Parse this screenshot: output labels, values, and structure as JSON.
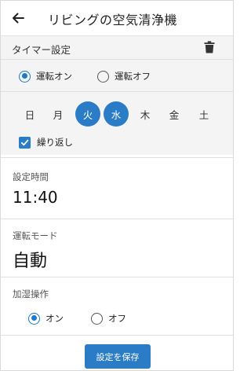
{
  "header": {
    "back_icon": "arrow-left-icon",
    "title": "リビングの空気清浄機"
  },
  "timer": {
    "label": "タイマー設定",
    "delete_icon": "trash-icon",
    "power_options": [
      {
        "label": "運転オン",
        "selected": true
      },
      {
        "label": "運転オフ",
        "selected": false
      }
    ],
    "days": [
      {
        "label": "日",
        "selected": false
      },
      {
        "label": "月",
        "selected": false
      },
      {
        "label": "火",
        "selected": true
      },
      {
        "label": "水",
        "selected": true
      },
      {
        "label": "木",
        "selected": false
      },
      {
        "label": "金",
        "selected": false
      },
      {
        "label": "土",
        "selected": false
      }
    ],
    "repeat": {
      "label": "繰り返し",
      "checked": true
    }
  },
  "set_time": {
    "label": "設定時間",
    "value": "11:40"
  },
  "run_mode": {
    "label": "運転モード",
    "value": "自動"
  },
  "humidify": {
    "label": "加湿操作",
    "options": [
      {
        "label": "オン",
        "selected": true
      },
      {
        "label": "オフ",
        "selected": false
      }
    ]
  },
  "save_button": {
    "label": "設定を保存"
  },
  "colors": {
    "accent": "#2b7cc6",
    "section_bg": "#f4f4f4"
  }
}
